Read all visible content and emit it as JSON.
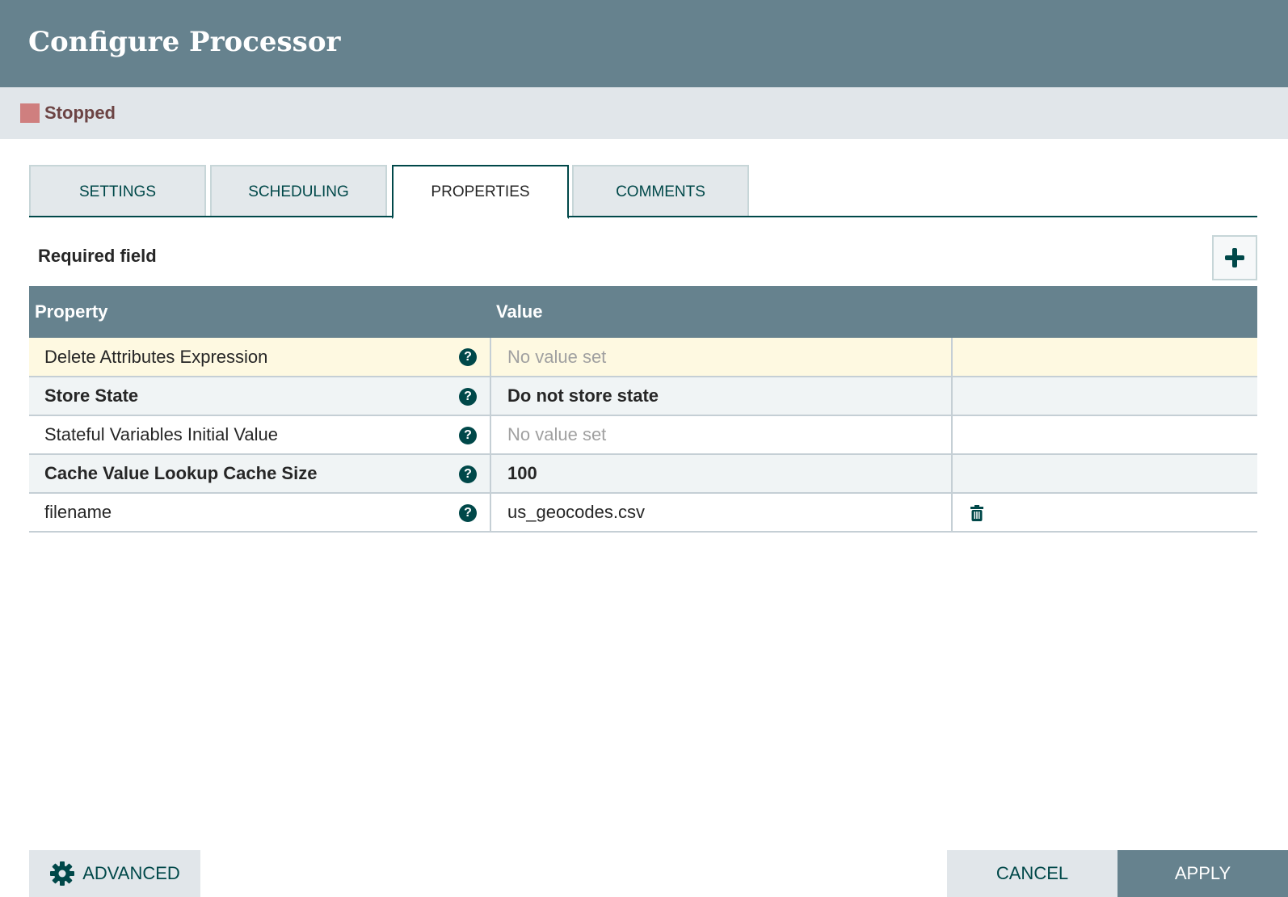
{
  "header": {
    "title": "Configure Processor"
  },
  "status": {
    "label": "Stopped",
    "color": "#cf7f7f"
  },
  "tabs": [
    {
      "label": "SETTINGS"
    },
    {
      "label": "SCHEDULING"
    },
    {
      "label": "PROPERTIES",
      "active": true
    },
    {
      "label": "COMMENTS"
    }
  ],
  "properties": {
    "required_label": "Required field",
    "add_icon": "plus-icon",
    "columns": [
      "Property",
      "Value"
    ],
    "rows": [
      {
        "name": "Delete Attributes Expression",
        "value": "No value set",
        "required": false,
        "placeholder": true
      },
      {
        "name": "Store State",
        "value": "Do not store state",
        "required": true,
        "placeholder": false
      },
      {
        "name": "Stateful Variables Initial Value",
        "value": "No value set",
        "required": false,
        "placeholder": true
      },
      {
        "name": "Cache Value Lookup Cache Size",
        "value": "100",
        "required": true,
        "placeholder": false
      },
      {
        "name": "filename",
        "value": "us_geocodes.csv",
        "required": false,
        "placeholder": false,
        "deletable": true
      }
    ]
  },
  "footer": {
    "advanced": "ADVANCED",
    "cancel": "CANCEL",
    "apply": "APPLY"
  }
}
